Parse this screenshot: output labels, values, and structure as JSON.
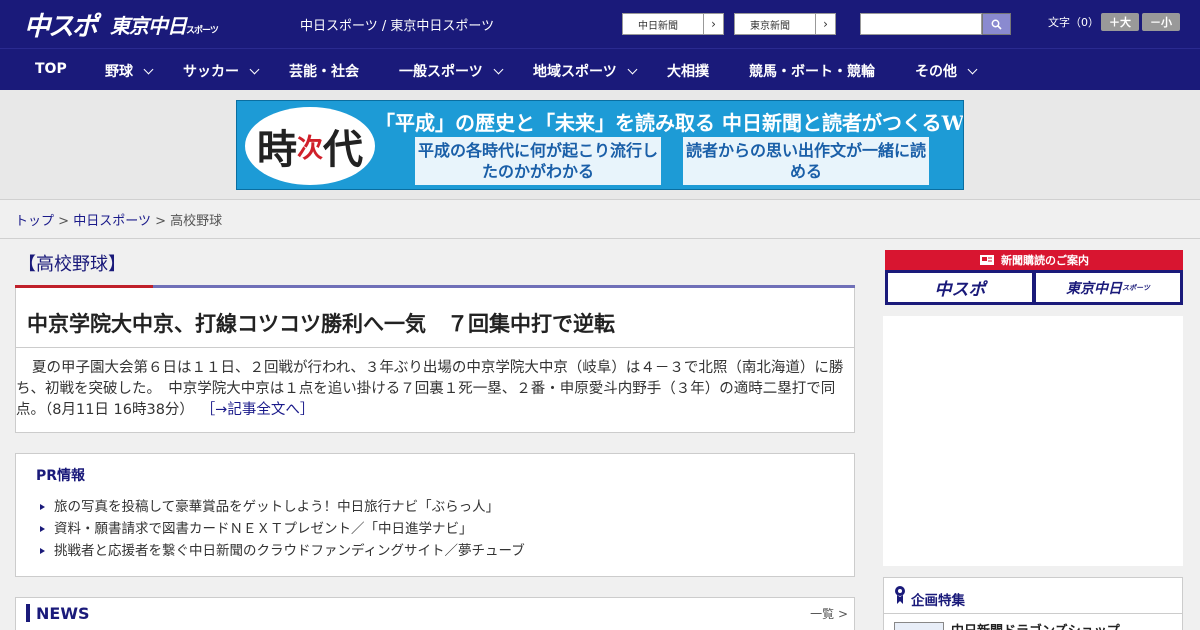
{
  "header": {
    "logo_chunichi_sports": "中スポ",
    "logo_tokyo_chunichi": "東京中日",
    "logo_tokyo_suffix": "スポーツ",
    "site_names": "中日スポーツ / 東京中日スポーツ",
    "link_chunichi": "中日新聞",
    "link_tokyo": "東京新聞",
    "search_placeholder": "",
    "font_label": "文字（0）",
    "font_larger": "＋大",
    "font_smaller": "－小",
    "accent_color": "#1a1a7a"
  },
  "nav": {
    "items": [
      {
        "label": "TOP",
        "has_menu": false
      },
      {
        "label": "野球",
        "has_menu": true
      },
      {
        "label": "サッカー",
        "has_menu": true
      },
      {
        "label": "芸能・社会",
        "has_menu": false
      },
      {
        "label": "一般スポーツ",
        "has_menu": true
      },
      {
        "label": "地域スポーツ",
        "has_menu": true
      },
      {
        "label": "大相撲",
        "has_menu": false
      },
      {
        "label": "競馬・ボート・競輪",
        "has_menu": false
      },
      {
        "label": "その他",
        "has_menu": true
      }
    ]
  },
  "banner": {
    "logo_a": "時",
    "logo_b": "次",
    "logo_c": "代",
    "headline": "「平成」の歴史と「未来」を読み取る 中日新聞と読者がつくるWebサイト",
    "box1": "平成の各時代に何が起こり流行したのかがわかる",
    "box2": "読者からの思い出作文が一緒に読める"
  },
  "breadcrumb": {
    "top": "トップ",
    "section": "中日スポーツ",
    "current": "高校野球",
    "sep": ">"
  },
  "article": {
    "category": "【高校野球】",
    "title": "中京学院大中京、打線コツコツ勝利へ一気　７回集中打で逆転",
    "body": "夏の甲子園大会第６日は１１日、２回戦が行われ、３年ぶり出場の中京学院大中京（岐阜）は４－３で北照（南北海道）に勝ち、初戦を突破した。　中京学院大中京は１点を追い掛ける７回裏１死一塁、２番・申原愛斗内野手（３年）の適時二塁打で同点。（8月11日 16時38分）",
    "more_link": "［→記事全文へ］"
  },
  "pr": {
    "title": "PR情報",
    "items": [
      "旅の写真を投稿して豪華賞品をゲットしよう！中日旅行ナビ「ぶらっ人」",
      "資料・願書請求で図書カードＮＥＸＴプレゼント／「中日進学ナビ」",
      "挑戦者と応援者を繋ぐ中日新聞のクラウドファンディングサイト／夢チューブ"
    ]
  },
  "news": {
    "title": "NEWS",
    "more": "一覧 >"
  },
  "sidebar": {
    "subscription_title": "新聞購読のご案内",
    "sub_btn1": "中スポ",
    "sub_btn2": "東京中日",
    "sub_btn2_suffix": "スポーツ",
    "feature_title": "企画特集",
    "feature_item": "中日新聞ドラゴンズショップ"
  }
}
